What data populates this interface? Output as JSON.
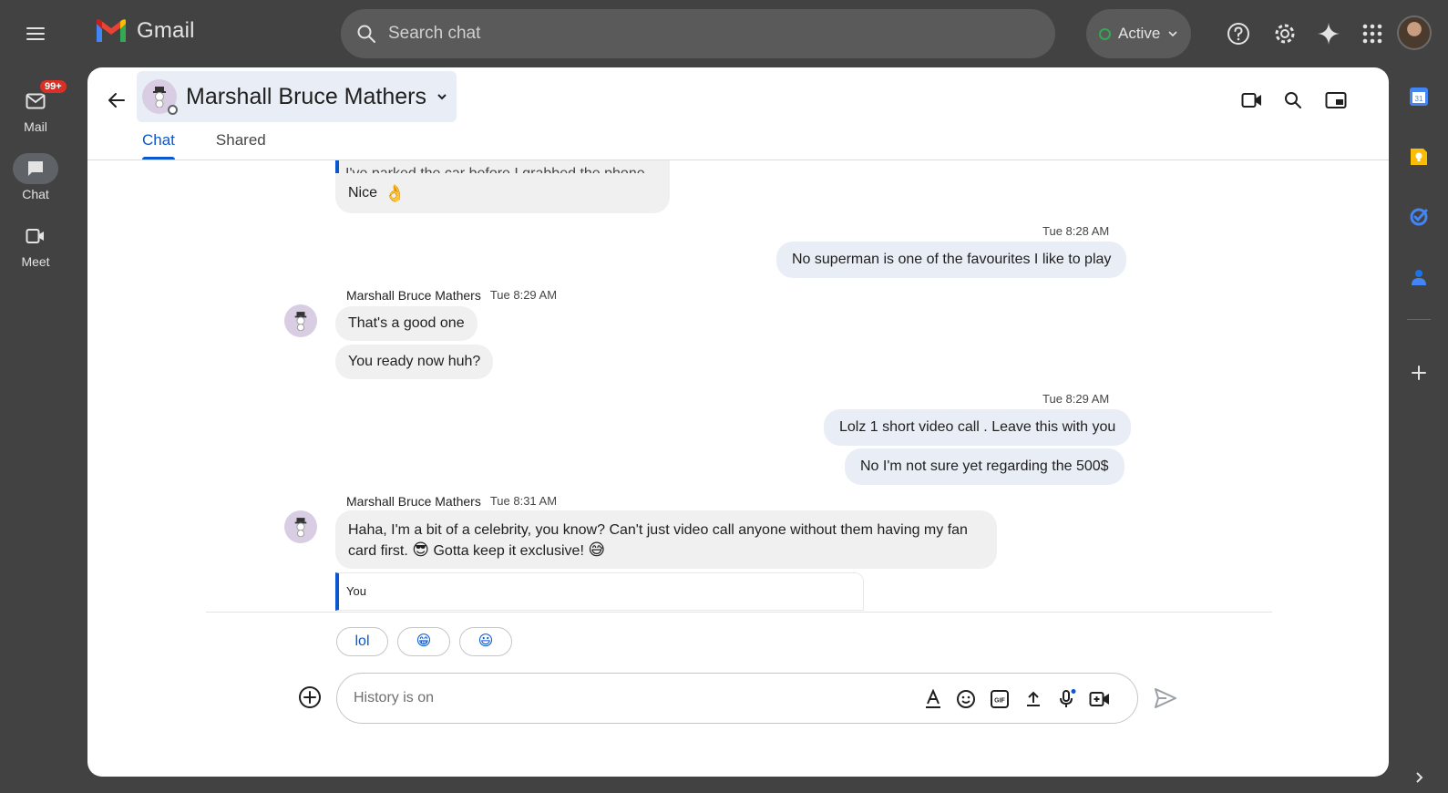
{
  "app": {
    "name": "Gmail",
    "brand_colors": {
      "red": "#ea4335",
      "blue": "#4285f4",
      "green": "#34a853",
      "yellow": "#fbbc04"
    }
  },
  "search": {
    "placeholder": "Search chat"
  },
  "status": {
    "label": "Active",
    "color": "#34a853"
  },
  "top_icons": [
    "help-icon",
    "settings-icon",
    "gemini-sparkle-icon",
    "apps-grid-icon"
  ],
  "rail": {
    "items": [
      {
        "label": "Mail",
        "icon": "mail-icon",
        "badge": "99+"
      },
      {
        "label": "Chat",
        "icon": "chat-icon",
        "active": true
      },
      {
        "label": "Meet",
        "icon": "meet-icon"
      }
    ]
  },
  "right_rail": [
    "calendar-icon",
    "keep-icon",
    "tasks-icon",
    "contacts-icon",
    "add-icon",
    "expand-icon"
  ],
  "chat": {
    "contact_name": "Marshall Bruce Mathers",
    "tabs": [
      {
        "label": "Chat",
        "active": true
      },
      {
        "label": "Shared"
      }
    ],
    "quoted_fragment": "I've parked the car before I grabbed the phone",
    "messages": {
      "nice": {
        "text": "Nice",
        "emoji": "👌"
      },
      "out1": {
        "time": "Tue 8:28 AM",
        "text": "No superman is one of the favourites I like to play"
      },
      "in1": {
        "sender": "Marshall Bruce Mathers",
        "time": "Tue 8:29 AM",
        "lines": [
          "That's a good one",
          "You ready now huh?"
        ]
      },
      "out2": {
        "time": "Tue 8:29 AM",
        "lines": [
          "Lolz 1 short video call . Leave this with you",
          "No I'm not sure yet regarding the 500$"
        ]
      },
      "in2": {
        "sender": "Marshall Bruce Mathers",
        "time": "Tue 8:31 AM",
        "line1": "Haha, I'm a bit of a celebrity, you know? Can't just video call anyone without them having my fan",
        "line2_a": "card first.",
        "emoji_a": "😎",
        "line2_b": "Gotta keep it exclusive!",
        "emoji_b": "😅"
      }
    },
    "reply_preview": {
      "label": "You"
    },
    "suggestions": [
      "lol",
      "😁",
      "😃"
    ],
    "composer": {
      "placeholder": "History is on"
    }
  }
}
